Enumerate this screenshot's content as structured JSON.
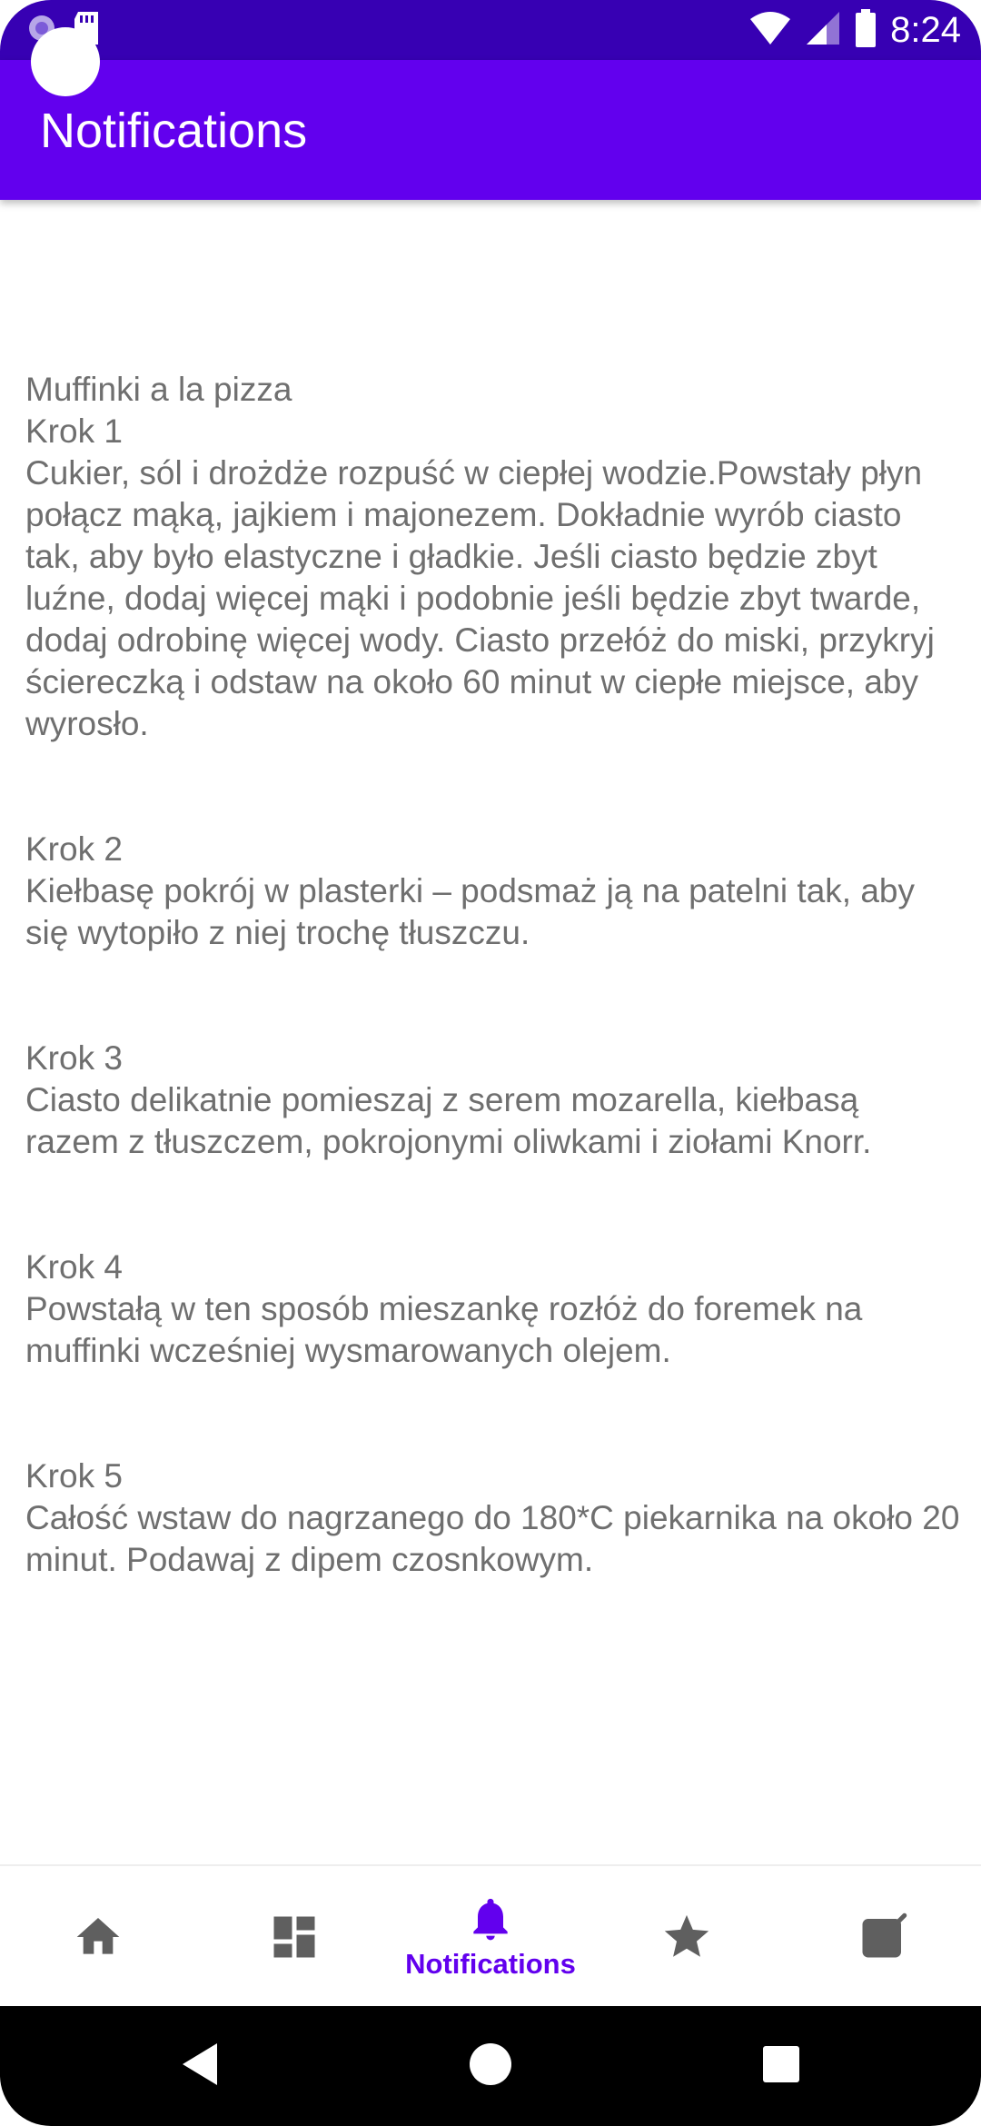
{
  "status_bar": {
    "time": "8:24",
    "icons": [
      "notification-dot-icon",
      "sd-card-icon",
      "wifi-icon",
      "signal-icon",
      "battery-icon"
    ]
  },
  "app_bar": {
    "title": "Notifications"
  },
  "recipe": {
    "title": "Muffinki a la pizza",
    "steps": [
      {
        "heading": "Krok 1",
        "text": "Cukier, sól i drożdże rozpuść w ciepłej wodzie.Powstały płyn połącz mąką, jajkiem i majonezem. Dokładnie wyrób ciasto tak, aby było elastyczne i gładkie. Jeśli ciasto będzie zbyt luźne, dodaj więcej mąki i podobnie jeśli będzie zbyt twarde, dodaj odrobinę więcej wody. Ciasto przełóż do miski, przykryj ściereczką i odstaw na około 60 minut w ciepłe miejsce, aby wyrosło."
      },
      {
        "heading": "Krok 2",
        "text": "Kiełbasę pokrój w plasterki – podsmaż ją na patelni tak, aby się wytopiło z niej trochę tłuszczu."
      },
      {
        "heading": "Krok 3",
        "text": "Ciasto delikatnie pomieszaj z serem mozarella, kiełbasą razem z tłuszczem, pokrojonymi oliwkami i ziołami Knorr."
      },
      {
        "heading": "Krok 4",
        "text": "Powstałą w ten sposób mieszankę rozłóż do foremek na muffinki wcześniej wysmarowanych olejem."
      },
      {
        "heading": "Krok 5",
        "text": "Całość wstaw do nagrzanego do 180*C piekarnika na około 20 minut. Podawaj z dipem czosnkowym."
      }
    ]
  },
  "bottom_nav": {
    "active_label": "Notifications",
    "items": [
      "home-icon",
      "dashboard-icon",
      "notifications-icon",
      "star-icon",
      "note-icon"
    ]
  },
  "colors": {
    "status_bar": "#3700b3",
    "app_bar": "#6200ee",
    "text": "#6f6f6f",
    "nav_inactive": "#5f5f5f",
    "nav_active": "#6200ee"
  }
}
